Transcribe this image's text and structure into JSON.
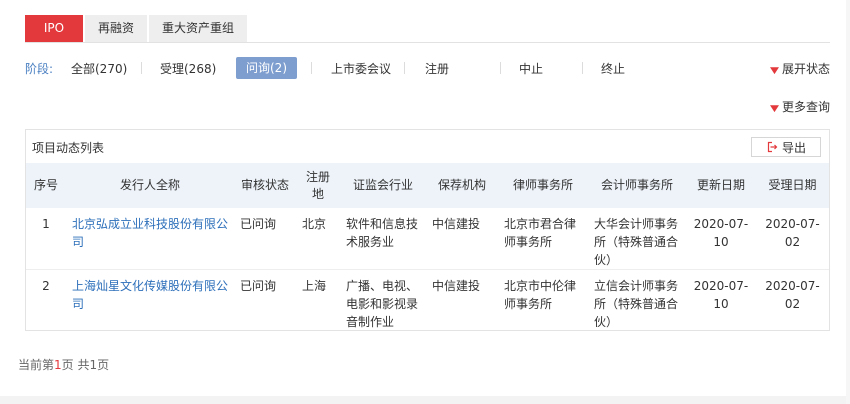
{
  "tabs": [
    {
      "label": "IPO"
    },
    {
      "label": "再融资"
    },
    {
      "label": "重大资产重组"
    }
  ],
  "stages": {
    "label": "阶段:",
    "items": [
      {
        "label": "全部(270)"
      },
      {
        "label": "受理(268)"
      },
      {
        "label": "问询(2)"
      },
      {
        "label": "上市委会议"
      },
      {
        "label": "注册"
      },
      {
        "label": "中止"
      },
      {
        "label": "终止"
      }
    ],
    "active_index": 2,
    "expand_label": "展开状态",
    "more_query_label": "更多查询"
  },
  "panel": {
    "title": "项目动态列表",
    "export_label": "导出"
  },
  "table": {
    "headers": [
      "序号",
      "发行人全称",
      "审核状态",
      "注册地",
      "证监会行业",
      "保荐机构",
      "律师事务所",
      "会计师事务所",
      "更新日期",
      "受理日期"
    ],
    "rows": [
      [
        "1",
        "北京弘成立业科技股份有限公司",
        "已问询",
        "北京",
        "软件和信息技术服务业",
        "中信建投",
        "北京市君合律师事务所",
        "大华会计师事务所（特殊普通合伙）",
        "2020-07-10",
        "2020-07-02"
      ],
      [
        "2",
        "上海灿星文化传媒股份有限公司",
        "已问询",
        "上海",
        "广播、电视、电影和影视录音制作业",
        "中信建投",
        "北京市中伦律师事务所",
        "立信会计师事务所（特殊普通合伙）",
        "2020-07-10",
        "2020-07-02"
      ]
    ]
  },
  "pager": {
    "prefix": "当前第",
    "current": "1",
    "mid": "页 共",
    "total": "1",
    "suffix": "页"
  },
  "colors": {
    "accent": "#e4393c",
    "active_stage": "#7e9ecf",
    "link": "#2d6fba",
    "header_bg": "#edf3f9"
  },
  "icons": {
    "chevron": "chevron-down-icon",
    "export": "export-icon"
  }
}
